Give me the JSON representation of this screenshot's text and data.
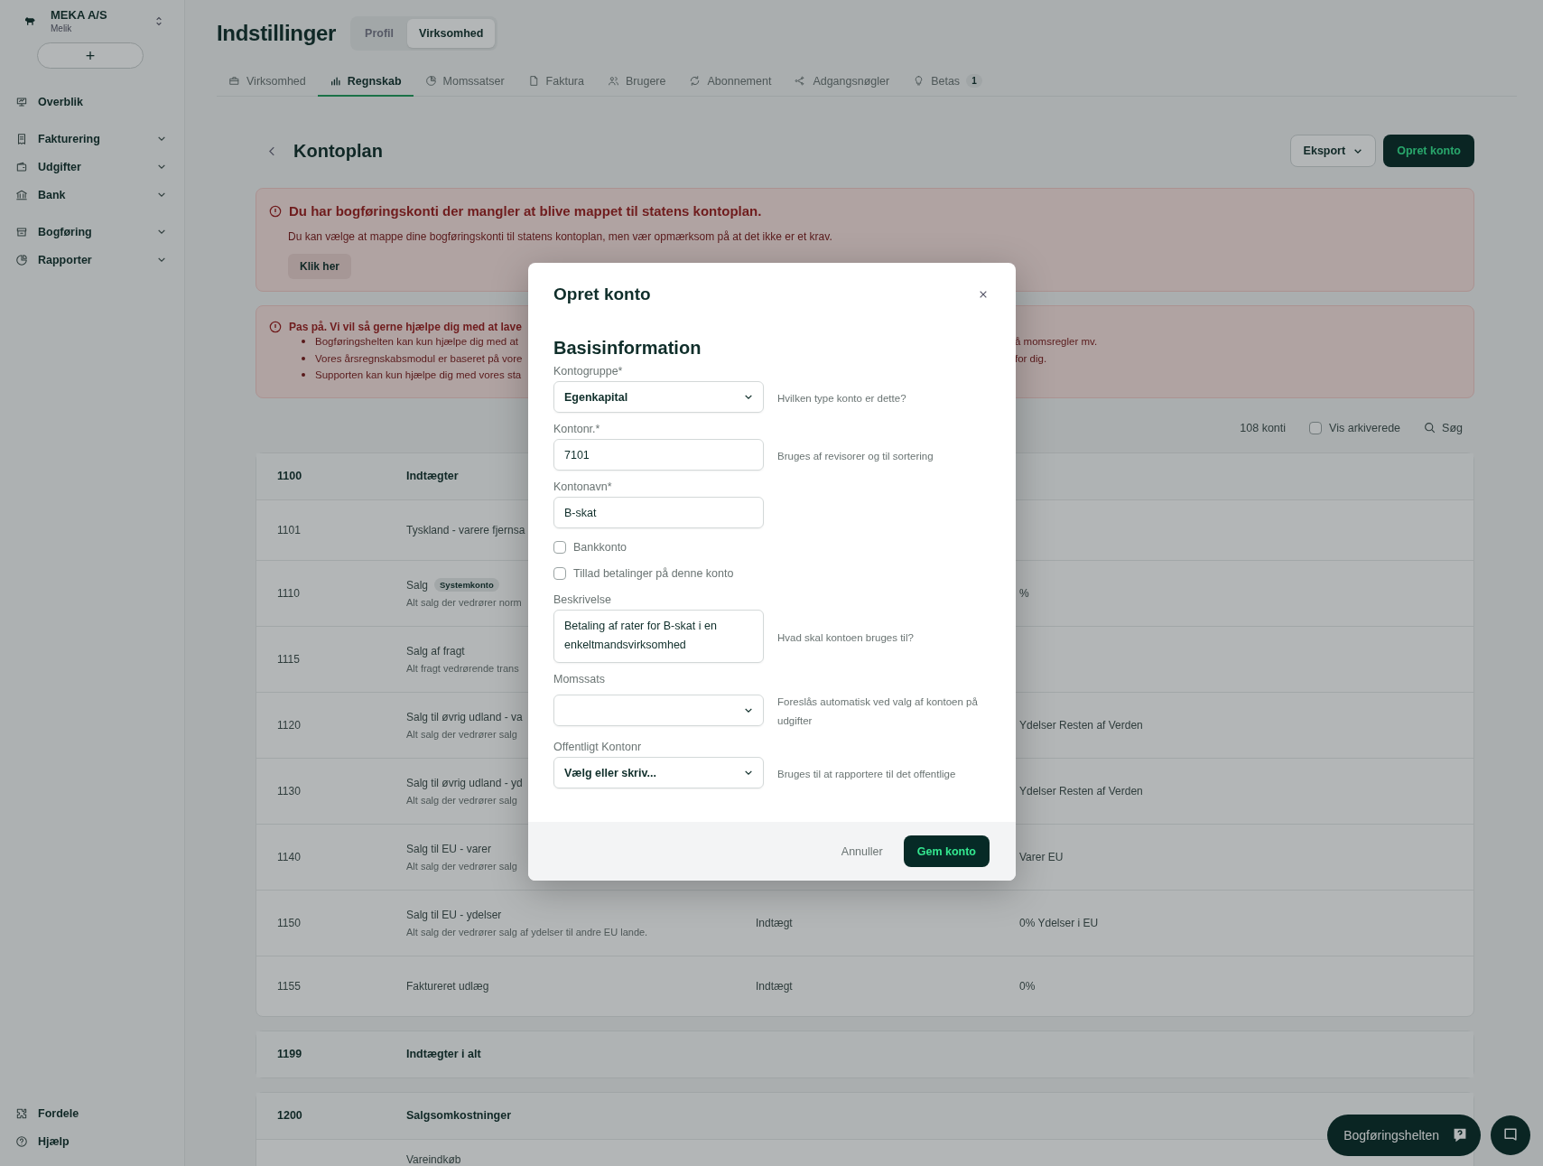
{
  "sidebar": {
    "company": {
      "name": "MEKA A/S",
      "sub": "Melik"
    },
    "add_button": "+",
    "groups": [
      [
        {
          "label": "Overblik",
          "expandable": false
        }
      ],
      [
        {
          "label": "Fakturering",
          "expandable": true
        },
        {
          "label": "Udgifter",
          "expandable": true
        },
        {
          "label": "Bank",
          "expandable": true
        }
      ],
      [
        {
          "label": "Bogføring",
          "expandable": true
        },
        {
          "label": "Rapporter",
          "expandable": true
        }
      ]
    ],
    "bottom_items": [
      {
        "label": "Fordele"
      },
      {
        "label": "Hjælp"
      }
    ]
  },
  "header": {
    "title": "Indstillinger",
    "segments": [
      {
        "label": "Profil",
        "selected": false
      },
      {
        "label": "Virksomhed",
        "selected": true
      }
    ]
  },
  "tabs": [
    {
      "label": "Virksomhed",
      "selected": false
    },
    {
      "label": "Regnskab",
      "selected": true
    },
    {
      "label": "Momssatser",
      "selected": false
    },
    {
      "label": "Faktura",
      "selected": false
    },
    {
      "label": "Brugere",
      "selected": false
    },
    {
      "label": "Abonnement",
      "selected": false
    },
    {
      "label": "Adgangsnøgler",
      "selected": false
    },
    {
      "label": "Betas",
      "selected": false,
      "badge": "1"
    }
  ],
  "page": {
    "title": "Kontoplan",
    "export_button": "Eksport",
    "create_button": "Opret konto"
  },
  "alerts": [
    {
      "title": "Du har bogføringskonti der mangler at blive mappet til statens kontoplan.",
      "body": "Du kan vælge at mappe dine bogføringskonti til statens kontoplan, men vær opmærksom på at det ikke er et krav.",
      "button": "Klik her"
    },
    {
      "title": "Pas på. Vi vil så gerne hjælpe dig med at lave",
      "items": [
        {
          "left": "Bogføringshelten kan kun hjælpe dig med at",
          "right": "å momsregler mv."
        },
        {
          "left": "Vores årsregnskabsmodul er baseret på vore",
          "right": "for dig."
        },
        {
          "left": "Supporten kan kun hjælpe dig med vores sta"
        }
      ]
    }
  ],
  "toolbar": {
    "count": "108 konti",
    "archived": {
      "label": "Vis arkiverede",
      "checked": false
    },
    "search": "Søg"
  },
  "cards": [
    {
      "rows": [
        {
          "kind": "group",
          "number": "1100",
          "name": "Indtægter"
        },
        {
          "kind": "account",
          "number": "1101",
          "name": "Tyskland - varere fjernsa"
        },
        {
          "kind": "account",
          "number": "1110",
          "name": "Salg",
          "badge": "Systemkonto",
          "description": "Alt salg der vedrører norm",
          "vat": "%"
        },
        {
          "kind": "account",
          "number": "1115",
          "name": "Salg af fragt",
          "description": "Alt fragt vedrørende trans"
        },
        {
          "kind": "account",
          "number": "1120",
          "name": "Salg til øvrig udland - va",
          "description": "Alt salg der vedrører salg",
          "vat": "Ydelser Resten af Verden"
        },
        {
          "kind": "account",
          "number": "1130",
          "name": "Salg til øvrig udland - yd",
          "description": "Alt salg der vedrører salg",
          "vat": "Ydelser Resten af Verden"
        },
        {
          "kind": "account",
          "number": "1140",
          "name": "Salg til EU - varer",
          "description": "Alt salg der vedrører salg",
          "vat": "Varer EU"
        },
        {
          "kind": "account",
          "number": "1150",
          "name": "Salg til EU - ydelser",
          "description": "Alt salg der vedrører salg af ydelser til andre EU lande.",
          "type": "Indtægt",
          "vat": "0% Ydelser i EU"
        },
        {
          "kind": "account",
          "number": "1155",
          "name": "Faktureret udlæg",
          "type": "Indtægt",
          "vat": "0%"
        }
      ]
    },
    {
      "rows": [
        {
          "kind": "group",
          "number": "1199",
          "name": "Indtægter i alt"
        }
      ]
    },
    {
      "rows": [
        {
          "kind": "group",
          "number": "1200",
          "name": "Salgsomkostninger"
        },
        {
          "kind": "account",
          "name": "Vareindkøb"
        }
      ]
    }
  ],
  "modal": {
    "title": "Opret konto",
    "section": "Basisinformation",
    "fields": [
      {
        "kind": "select",
        "label": "Kontogruppe*",
        "value": "Egenkapital",
        "hint": "Hvilken type konto er dette?"
      },
      {
        "kind": "input",
        "label": "Kontonr.*",
        "value": "7101",
        "hint": "Bruges af revisorer og til sortering"
      },
      {
        "kind": "input",
        "label": "Kontonavn*",
        "value": "B-skat"
      },
      {
        "kind": "checkbox",
        "label": "Bankkonto",
        "checked": false
      },
      {
        "kind": "checkbox",
        "label": "Tillad betalinger på denne konto",
        "checked": false
      },
      {
        "kind": "textarea",
        "label": "Beskrivelse",
        "value": "Betaling af rater for B-skat i en enkeltmandsvirksomhed",
        "hint": "Hvad skal kontoen bruges til?"
      },
      {
        "kind": "select",
        "label": "Momssats",
        "hint": "Foreslås automatisk ved valg af kontoen på udgifter"
      },
      {
        "kind": "select",
        "label": "Offentligt Kontonr",
        "value": "Vælg eller skriv...",
        "hint": "Bruges til at rapportere til det offentlige"
      }
    ],
    "cancel": "Annuller",
    "save": "Gem konto"
  },
  "helper_button": "Bogføringshelten"
}
